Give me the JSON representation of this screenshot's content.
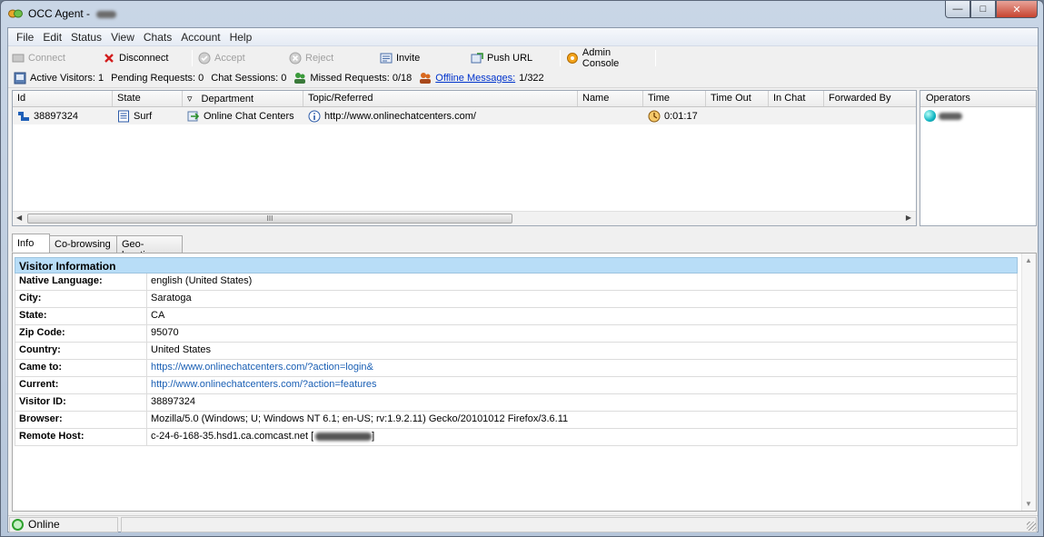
{
  "window": {
    "title": "OCC Agent - "
  },
  "menu": [
    "File",
    "Edit",
    "Status",
    "View",
    "Chats",
    "Account",
    "Help"
  ],
  "toolbar": {
    "connect": "Connect",
    "disconnect": "Disconnect",
    "accept": "Accept",
    "reject": "Reject",
    "invite": "Invite",
    "push_url": "Push URL",
    "admin_console": "Admin Console"
  },
  "stats": {
    "active_visitors": "Active Visitors: 1",
    "pending_requests": "Pending Requests: 0",
    "chat_sessions": "Chat Sessions: 0",
    "missed_requests": "Missed Requests: 0/18",
    "offline_messages_label": "Offline Messages:",
    "offline_messages_value": "1/322"
  },
  "grid": {
    "columns": [
      "Id",
      "State",
      "Department",
      "Topic/Referred",
      "Name",
      "Time",
      "Time Out",
      "In Chat",
      "Forwarded By"
    ],
    "rows": [
      {
        "id": "38897324",
        "state": "Surf",
        "department": "Online Chat Centers",
        "topic": "http://www.onlinechatcenters.com/",
        "name": "",
        "time": "0:01:17",
        "time_out": "",
        "in_chat": "",
        "forwarded_by": ""
      }
    ],
    "scroll_marker": "III"
  },
  "operators": {
    "header": "Operators"
  },
  "tabs": [
    "Info",
    "Co-browsing",
    "Geo-location"
  ],
  "info": {
    "section_title": "Visitor Information",
    "rows": [
      {
        "label": "Native Language:",
        "value": "english (United States)"
      },
      {
        "label": "City:",
        "value": "Saratoga"
      },
      {
        "label": "State:",
        "value": "CA"
      },
      {
        "label": "Zip Code:",
        "value": "95070"
      },
      {
        "label": "Country:",
        "value": "United States"
      },
      {
        "label": "Came to:",
        "value": "https://www.onlinechatcenters.com/?action=login&"
      },
      {
        "label": "Current:",
        "value": "http://www.onlinechatcenters.com/?action=features"
      },
      {
        "label": "Visitor ID:",
        "value": "38897324"
      },
      {
        "label": "Browser:",
        "value": "Mozilla/5.0 (Windows; U; Windows NT 6.1; en-US; rv:1.9.2.11) Gecko/20101012 Firefox/3.6.11"
      },
      {
        "label": "Remote Host:",
        "value": "c-24-6-168-35.hsd1.ca.comcast.net [",
        "suffix": "]"
      }
    ]
  },
  "status": {
    "text": "Online"
  },
  "colors": {
    "header_blue": "#b8ddf7",
    "link_blue": "#0033cc",
    "online_green": "#2ea12e"
  }
}
